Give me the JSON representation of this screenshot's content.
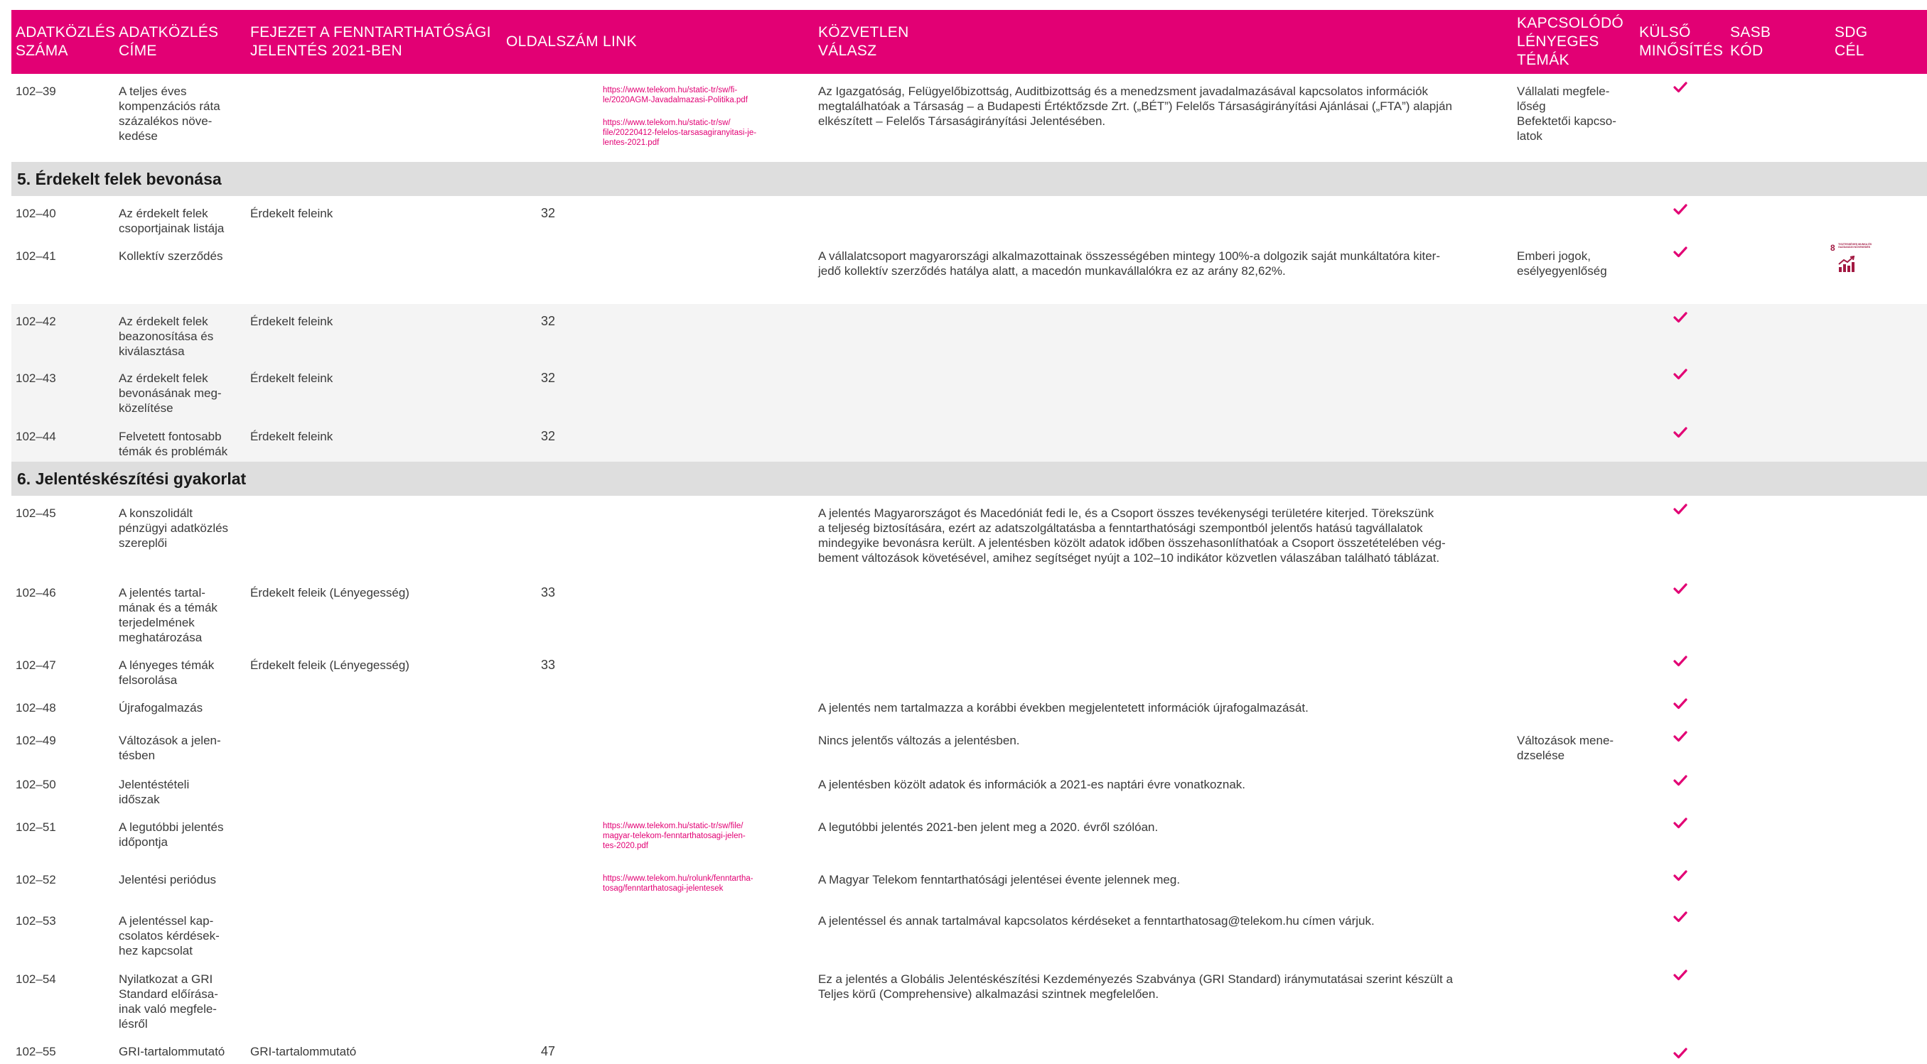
{
  "colors": {
    "brand": "#e20074",
    "section_bg": "#dedede",
    "alt_row": "#f4f4f4"
  },
  "header": {
    "c1": "ADATKÖZLÉS\nSZÁMA",
    "c2": "ADATKÖZLÉS\nCÍME",
    "c3": "FEJEZET A FENNTARTHATÓSÁGI\nJELENTÉS 2021-BEN",
    "c4": "OLDALSZÁM",
    "c5": "LINK",
    "c6": "KÖZVETLEN\nVÁLASZ",
    "c7": "KAPCSOLÓDÓ\nLÉNYEGES\nTÉMÁK",
    "c8": "KÜLSŐ\nMINŐSÍTÉS",
    "c9": "SASB\nKÓD",
    "c10": "SDG\nCÉL"
  },
  "sections": {
    "s5": "5. Érdekelt felek bevonása",
    "s6": "6. Jelentéskészítési gyakorlat"
  },
  "rows": {
    "r39": {
      "id": "102–39",
      "title": "A teljes éves\nkompenzációs ráta\nszázalékos növe-\nkedése",
      "link1": "https://www.telekom.hu/static-tr/sw/fi-\nle/2020AGM-Javadalmazasi-Politika.pdf",
      "link2": "https://www.telekom.hu/static-tr/sw/\nfile/20220412-felelos-tarsasagiranyitasi-je-\nlentes-2021.pdf",
      "answer": "Az Igazgatóság, Felügyelőbizottság, Auditbizottság és a menedzsment javadalmazásával kapcsolatos információk\nmegtalálhatóak a Társaság – a Budapesti Értéktőzsde Zrt. („BÉT”) Felelős Társaságirányítási Ajánlásai („FTA”) alapján\nelkészített – Felelős Társaságirányítási Jelentésében.",
      "topics": "Vállalati megfele-\nlőség\nBefektetői kapcso-\nlatok"
    },
    "r40": {
      "id": "102–40",
      "title": "Az érdekelt felek\ncsoportjainak listája",
      "chapter": "Érdekelt feleink",
      "page": "32"
    },
    "r41": {
      "id": "102–41",
      "title": "Kollektív szerződés",
      "answer": "A vállalatcsoport magyarországi alkalmazottainak összességében mintegy 100%-a dolgozik saját munkáltatóra kiter-\njedő kollektív szerződés hatálya alatt, a macedón munkavállalókra ez az arány 82,62%.",
      "topics": "Emberi jogok,\nesélyegyenlőség",
      "sdg_number": "8",
      "sdg_text": "TISZTESSÉGES MUNKA ÉS GAZDASÁGI NÖVEKEDÉS"
    },
    "r42": {
      "id": "102–42",
      "title": "Az érdekelt felek\nbeazonosítása és\nkiválasztása",
      "chapter": "Érdekelt feleink",
      "page": "32"
    },
    "r43": {
      "id": "102–43",
      "title": "Az érdekelt felek\nbevonásának meg-\nközelítése",
      "chapter": "Érdekelt feleink",
      "page": "32"
    },
    "r44": {
      "id": "102–44",
      "title": "Felvetett fontosabb\ntémák és problémák",
      "chapter": "Érdekelt feleink",
      "page": "32"
    },
    "r45": {
      "id": "102–45",
      "title": "A konszolidált\npénzügyi adatközlés\nszereplői",
      "answer": "A jelentés Magyarországot és Macedóniát fedi le, és a Csoport összes tevékenységi területére kiterjed. Törekszünk\na teljeség biztosítására, ezért az adatszolgáltatásba a fenntarthatósági szempontból jelentős hatású tagvállalatok\nmindegyike bevonásra került. A jelentésben közölt adatok időben összehasonlíthatóak a Csoport összetételében vég-\nbement változások követésével, amihez segítséget nyújt a 102–10 indikátor közvetlen válaszában található táblázat."
    },
    "r46": {
      "id": "102–46",
      "title": "A jelentés tartal-\nmának és a témák\nterjedelmének\nmeghatározása",
      "chapter": "Érdekelt feleik (Lényegesség)",
      "page": "33"
    },
    "r47": {
      "id": "102–47",
      "title": "A lényeges témák\nfelsorolása",
      "chapter": "Érdekelt feleik (Lényegesség)",
      "page": "33"
    },
    "r48": {
      "id": "102–48",
      "title": "Újrafogalmazás",
      "answer": "A jelentés nem tartalmazza a korábbi években megjelentetett információk újrafogalmazását."
    },
    "r49": {
      "id": "102–49",
      "title": "Változások a jelen-\ntésben",
      "answer": "Nincs jelentős változás a jelentésben.",
      "topics": "Változások mene-\ndzselése"
    },
    "r50": {
      "id": "102–50",
      "title": "Jelentéstételi\nidőszak",
      "answer": "A jelentésben közölt adatok és információk a 2021-es naptári évre vonatkoznak."
    },
    "r51": {
      "id": "102–51",
      "title": "A legutóbbi jelentés\nidőpontja",
      "link1": "https://www.telekom.hu/static-tr/sw/file/\nmagyar-telekom-fenntarthatosagi-jelen-\ntes-2020.pdf",
      "answer": "A legutóbbi jelentés 2021-ben jelent meg a 2020. évről szólóan."
    },
    "r52": {
      "id": "102–52",
      "title": "Jelentési periódus",
      "link1": "https://www.telekom.hu/rolunk/fenntartha-\ntosag/fenntarthatosagi-jelentesek",
      "answer": "A Magyar Telekom fenntarthatósági jelentései évente jelennek meg."
    },
    "r53": {
      "id": "102–53",
      "title": "A jelentéssel kap-\ncsolatos kérdések-\nhez kapcsolat",
      "answer": "A jelentéssel és annak tartalmával kapcsolatos kérdéseket a fenntarthatosag@telekom.hu címen várjuk."
    },
    "r54": {
      "id": "102–54",
      "title": "Nyilatkozat a GRI\nStandard előírása-\ninak való megfele-\nlésről",
      "answer": "Ez a jelentés a Globális Jelentéskészítési Kezdeményezés Szabványa (GRI Standard) iránymutatásai szerint készült a\nTeljes körű (Comprehensive) alkalmazási szintnek megfelelően."
    },
    "r55": {
      "id": "102–55",
      "title": "GRI-tartalommutató",
      "chapter": "GRI-tartalommutató",
      "page": "47"
    }
  }
}
